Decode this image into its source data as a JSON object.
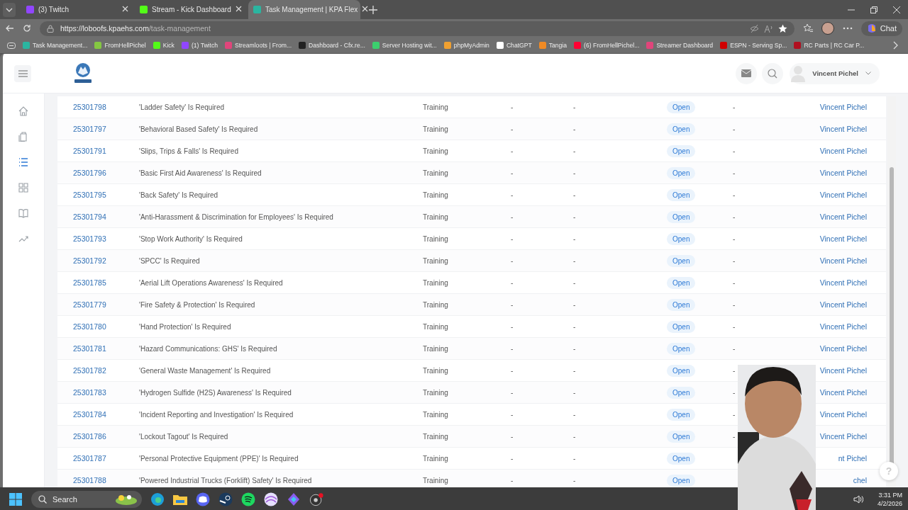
{
  "browser": {
    "tabs": [
      {
        "kind": "twitch",
        "title": "(3) Twitch",
        "selected": false
      },
      {
        "kind": "kick",
        "title": "Stream - Kick Dashboard",
        "selected": false
      },
      {
        "kind": "kpa",
        "title": "Task Management | KPA Flex",
        "selected": true
      }
    ],
    "url_host": "https://loboofs.kpaehs.com",
    "url_path": "/task-management",
    "chat": "Chat",
    "bookmarks": [
      {
        "kind": "kpa",
        "title": "Task Management..."
      },
      {
        "kind": "rumble",
        "title": "FromHellPichel"
      },
      {
        "kind": "kick",
        "title": "Kick"
      },
      {
        "kind": "twitch",
        "title": "(1) Twitch"
      },
      {
        "kind": "pink",
        "title": "Streamloots | From..."
      },
      {
        "kind": "cfx",
        "title": "Dashboard - Cfx.re..."
      },
      {
        "kind": "green",
        "title": "Server Hosting wit..."
      },
      {
        "kind": "pma",
        "title": "phpMyAdmin"
      },
      {
        "kind": "gpt",
        "title": "ChatGPT"
      },
      {
        "kind": "orange",
        "title": "Tangia"
      },
      {
        "kind": "youtube",
        "title": "(6) FromHellPichel..."
      },
      {
        "kind": "pink",
        "title": "Streamer Dashboard"
      },
      {
        "kind": "espn",
        "title": "ESPN - Serving Sp..."
      },
      {
        "kind": "rc",
        "title": "RC Parts | RC Car P..."
      }
    ]
  },
  "header": {
    "user": "Vincent Pichel"
  },
  "sidebar": [
    {
      "kind": "home",
      "selected": false
    },
    {
      "kind": "clipboard",
      "selected": false
    },
    {
      "kind": "list",
      "selected": true
    },
    {
      "kind": "grid",
      "selected": false
    },
    {
      "kind": "book",
      "selected": false
    },
    {
      "kind": "trend",
      "selected": false
    }
  ],
  "rows": [
    {
      "id": "25301798",
      "title": "'Ladder Safety' Is Required",
      "type": "Training",
      "col_4": "-",
      "col_5": "-",
      "status": "Open",
      "col_7": "-",
      "assignee": "Vincent Pichel"
    },
    {
      "id": "25301797",
      "title": "'Behavioral Based Safety' Is Required",
      "type": "Training",
      "col_4": "-",
      "col_5": "-",
      "status": "Open",
      "col_7": "-",
      "assignee": "Vincent Pichel"
    },
    {
      "id": "25301791",
      "title": "'Slips, Trips & Falls' Is Required",
      "type": "Training",
      "col_4": "-",
      "col_5": "-",
      "status": "Open",
      "col_7": "-",
      "assignee": "Vincent Pichel"
    },
    {
      "id": "25301796",
      "title": "'Basic First Aid Awareness' Is Required",
      "type": "Training",
      "col_4": "-",
      "col_5": "-",
      "status": "Open",
      "col_7": "-",
      "assignee": "Vincent Pichel"
    },
    {
      "id": "25301795",
      "title": "'Back Safety' Is Required",
      "type": "Training",
      "col_4": "-",
      "col_5": "-",
      "status": "Open",
      "col_7": "-",
      "assignee": "Vincent Pichel"
    },
    {
      "id": "25301794",
      "title": "'Anti-Harassment & Discrimination for Employees' Is Required",
      "type": "Training",
      "col_4": "-",
      "col_5": "-",
      "status": "Open",
      "col_7": "-",
      "assignee": "Vincent Pichel"
    },
    {
      "id": "25301793",
      "title": "'Stop Work Authority' Is Required",
      "type": "Training",
      "col_4": "-",
      "col_5": "-",
      "status": "Open",
      "col_7": "-",
      "assignee": "Vincent Pichel"
    },
    {
      "id": "25301792",
      "title": "'SPCC' Is Required",
      "type": "Training",
      "col_4": "-",
      "col_5": "-",
      "status": "Open",
      "col_7": "-",
      "assignee": "Vincent Pichel"
    },
    {
      "id": "25301785",
      "title": "'Aerial Lift Operations Awareness' Is Required",
      "type": "Training",
      "col_4": "-",
      "col_5": "-",
      "status": "Open",
      "col_7": "-",
      "assignee": "Vincent Pichel"
    },
    {
      "id": "25301779",
      "title": "'Fire Safety & Protection' Is Required",
      "type": "Training",
      "col_4": "-",
      "col_5": "-",
      "status": "Open",
      "col_7": "-",
      "assignee": "Vincent Pichel"
    },
    {
      "id": "25301780",
      "title": "'Hand Protection' Is Required",
      "type": "Training",
      "col_4": "-",
      "col_5": "-",
      "status": "Open",
      "col_7": "-",
      "assignee": "Vincent Pichel"
    },
    {
      "id": "25301781",
      "title": "'Hazard Communications: GHS' Is Required",
      "type": "Training",
      "col_4": "-",
      "col_5": "-",
      "status": "Open",
      "col_7": "-",
      "assignee": "Vincent Pichel"
    },
    {
      "id": "25301782",
      "title": "'General Waste Management' Is Required",
      "type": "Training",
      "col_4": "-",
      "col_5": "-",
      "status": "Open",
      "col_7": "-",
      "assignee": "Vincent Pichel"
    },
    {
      "id": "25301783",
      "title": "'Hydrogen Sulfide (H2S) Awareness' Is Required",
      "type": "Training",
      "col_4": "-",
      "col_5": "-",
      "status": "Open",
      "col_7": "-",
      "assignee": "Vincent Pichel"
    },
    {
      "id": "25301784",
      "title": "'Incident Reporting and Investigation' Is Required",
      "type": "Training",
      "col_4": "-",
      "col_5": "-",
      "status": "Open",
      "col_7": "-",
      "assignee": "Vincent Pichel"
    },
    {
      "id": "25301786",
      "title": "'Lockout Tagout' Is Required",
      "type": "Training",
      "col_4": "-",
      "col_5": "-",
      "status": "Open",
      "col_7": "-",
      "assignee": "Vincent Pichel"
    },
    {
      "id": "25301787",
      "title": "'Personal Protective Equipment (PPE)' Is Required",
      "type": "Training",
      "col_4": "-",
      "col_5": "-",
      "status": "Open",
      "assignee": "nt Pichel"
    },
    {
      "id": "25301788",
      "title": "'Powered Industrial Trucks (Forklift) Safety' Is Required",
      "type": "Training",
      "col_4": "-",
      "col_5": "-",
      "status": "Open",
      "assignee": "chel"
    }
  ],
  "help": "?",
  "taskbar": {
    "search": "Search",
    "time": "3:31 PM",
    "date": "4/2/2026"
  }
}
